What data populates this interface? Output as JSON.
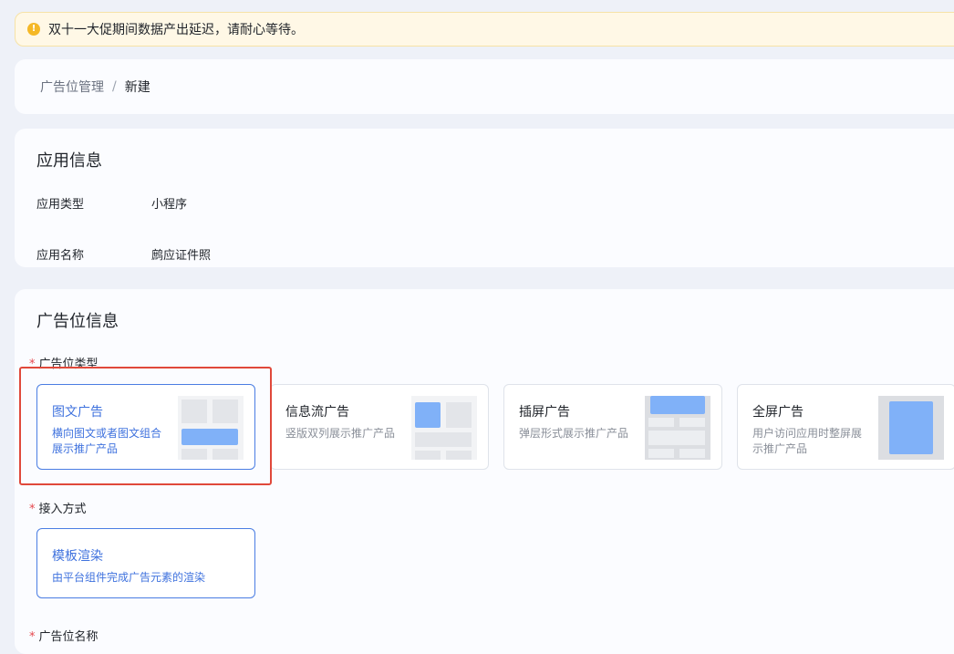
{
  "alert": {
    "icon": "warning-icon",
    "text": "双十一大促期间数据产出延迟，请耐心等待。"
  },
  "breadcrumb": {
    "parent": "广告位管理",
    "separator": "/",
    "current": "新建"
  },
  "app_info": {
    "title": "应用信息",
    "rows": [
      {
        "label": "应用类型",
        "value": "小程序"
      },
      {
        "label": "应用名称",
        "value": "鹧应证件照"
      }
    ]
  },
  "ad_info": {
    "title": "广告位信息",
    "type_label": "广告位类型",
    "required_mark": "*",
    "types": [
      {
        "title": "图文广告",
        "desc": "横向图文或者图文组合展示推广产品",
        "selected": true
      },
      {
        "title": "信息流广告",
        "desc": "竖版双列展示推广产品",
        "selected": false
      },
      {
        "title": "插屏广告",
        "desc": "弹层形式展示推广产品",
        "selected": false
      },
      {
        "title": "全屏广告",
        "desc": "用户访问应用时整屏展示推广产品",
        "selected": false
      }
    ],
    "access_label": "接入方式",
    "access": [
      {
        "title": "模板渲染",
        "desc": "由平台组件完成广告元素的渲染",
        "selected": true
      }
    ],
    "name_label": "广告位名称"
  },
  "colors": {
    "accent": "#3f72de",
    "highlight": "#e0483a",
    "warning": "#f5b826"
  }
}
